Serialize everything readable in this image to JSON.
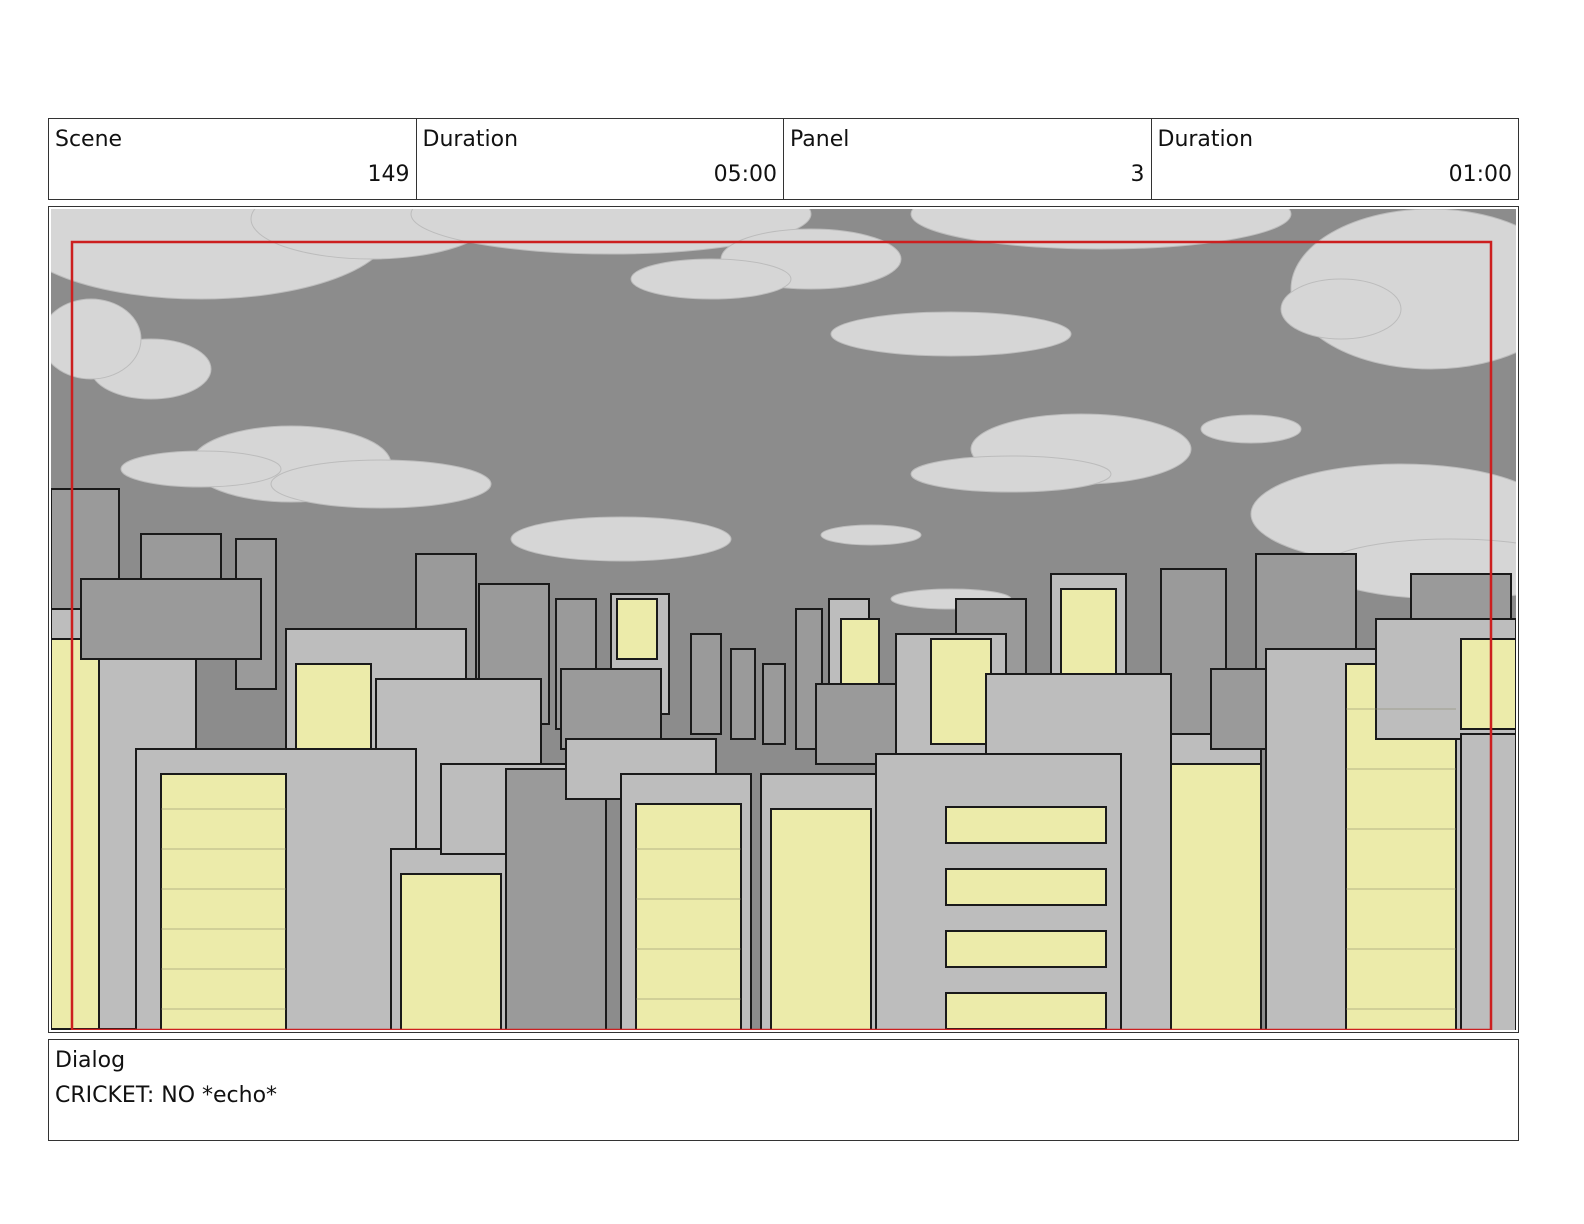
{
  "header": {
    "cells": [
      {
        "label": "Scene",
        "value": "149"
      },
      {
        "label": "Duration",
        "value": "05:00"
      },
      {
        "label": "Panel",
        "value": "3"
      },
      {
        "label": "Duration",
        "value": "01:00"
      }
    ]
  },
  "panel": {
    "colors": {
      "sky": "#8c8c8c",
      "cloud": "#d6d6d6",
      "building": "#bdbdbd",
      "building_dark": "#9a9a9a",
      "window_lit": "#ecebaa",
      "outline": "#1a1a1a",
      "safe_frame": "#cc1f1f"
    }
  },
  "dialog": {
    "label": "Dialog",
    "text": "CRICKET: NO *echo*"
  }
}
